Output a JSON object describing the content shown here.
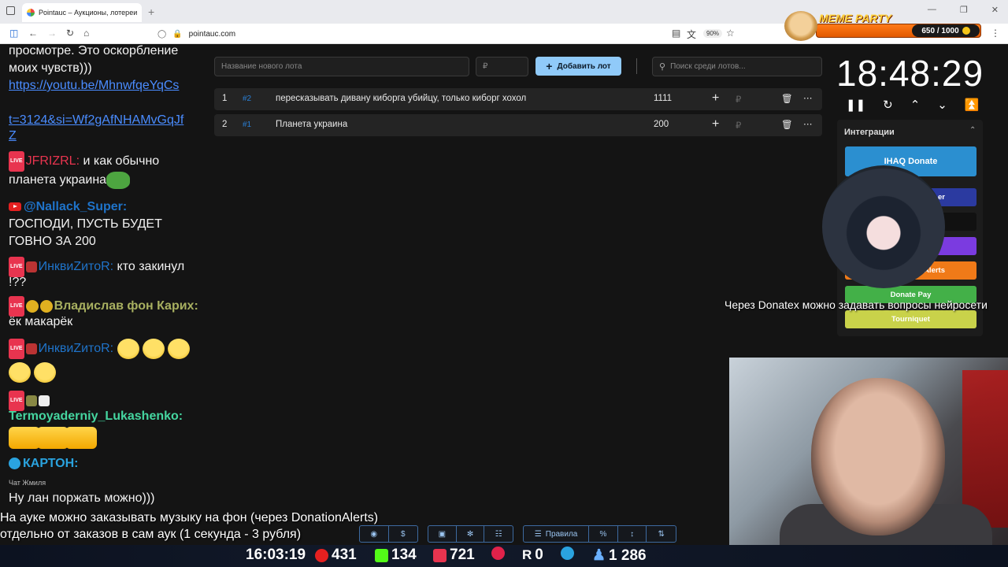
{
  "browser": {
    "tab_title": "Pointauc – Аукционы, лотереи",
    "tab_close": "✕",
    "new_tab": "+",
    "url": "pointauc.com",
    "zoom": "90%"
  },
  "meme_party": {
    "title": "MEME PARTY",
    "counter": "650 / 1000"
  },
  "chat": {
    "lines": [
      "просмотре. Это оскорбление",
      "моих чувств)))",
      "https://youtu.be/MhnwfqeYqCs",
      "t=3124&si=Wf2gAfNHAMvGqJf",
      "Z",
      "JFRIZRL:",
      " и как обычно",
      "планета украина",
      "@Nallack_Super:",
      "ГОСПОДИ, ПУСТЬ БУДЕТ",
      "ГОВНО ЗА 200",
      "ИнквиZитоR:",
      " кто закинул",
      "!??",
      "Владислав фон Карих:",
      "ёк макарёк",
      "ИнквиZитоR:",
      "Termoyaderniy_Lukashenko:",
      "КАРТОН:",
      "Чат Жмиля",
      "Ну лан поржать можно)))"
    ],
    "live_badge": "LIVE"
  },
  "app": {
    "new_lot_placeholder": "Название нового лота",
    "amount_placeholder": "₽",
    "add_button": "Добавить лот",
    "search_placeholder": "Поиск среди лотов...",
    "lots": [
      {
        "index": "1",
        "id": "#2",
        "name": "пересказывать дивану киборга убийцу, только киборг хохол",
        "amount": "1111",
        "currency": "₽"
      },
      {
        "index": "2",
        "id": "#1",
        "name": "Планета украина",
        "amount": "200",
        "currency": "₽"
      }
    ]
  },
  "timer": {
    "value": "18:48:29"
  },
  "integrations": {
    "title": "Интеграции",
    "buttons": [
      {
        "label": "IHAQ Donate",
        "color": "#2b8fd0"
      },
      {
        "label": "er",
        "color": "#2b3aa0"
      },
      {
        "label": "",
        "color": "#111111"
      },
      {
        "label": "",
        "color": "#7b3be0"
      },
      {
        "label": "Alerts",
        "color": "#f07a18"
      },
      {
        "label": "Donate Pay",
        "color": "#43b048"
      },
      {
        "label": "Tourniquet",
        "color": "#c9d24a"
      }
    ]
  },
  "overlays": {
    "donatex_note": "Через Donatex можно задавать вопросы нейросети",
    "auk_note_line1": "На ауке можно заказывать музыку на фон (через DonationAlerts)",
    "auk_note_line2": "отдельно от заказов в сам аук (1 секунда - 3 рубля)",
    "rules_label": "Правила",
    "percent_label": "%"
  },
  "status": {
    "time": "16:03:19",
    "youtube": "431",
    "kick": "134",
    "vk": "721",
    "rutube": "0",
    "telegram": "",
    "viewers": "1 286"
  },
  "colors": {
    "accent_button": "#90caf9",
    "lot_id": "#2a7fd4",
    "chat_name_red": "#e8344f",
    "chat_name_blue": "#1f73c9",
    "chat_name_olive": "#a8b060",
    "chat_name_green": "#45d6a0"
  }
}
